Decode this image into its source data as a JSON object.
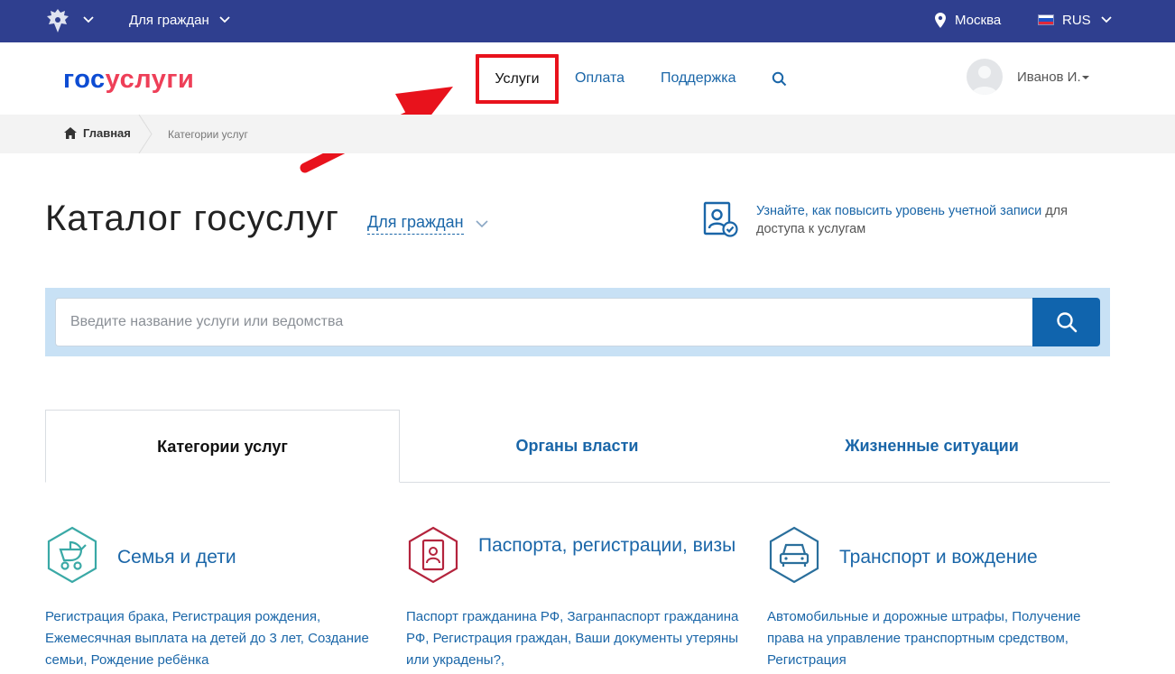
{
  "topbar": {
    "audience": "Для граждан",
    "location": "Москва",
    "language": "RUS",
    "colors": {
      "background": "#2f3f8f"
    }
  },
  "header": {
    "logo": {
      "part1": "гос",
      "part2": "услуги"
    },
    "nav": {
      "services": "Услуги",
      "payment": "Оплата",
      "support": "Поддержка"
    },
    "user": "Иванов И."
  },
  "breadcrumbs": {
    "home": "Главная",
    "current": "Категории услуг"
  },
  "catalog": {
    "title": "Каталог госуслуг",
    "audience": "Для граждан",
    "promo_link": "Узнайте, как повысить уровень учетной записи",
    "promo_rest": " для доступа к услугам"
  },
  "search": {
    "placeholder": "Введите название услуги или ведомства",
    "value": ""
  },
  "tabs": [
    {
      "label": "Категории услуг",
      "active": true
    },
    {
      "label": "Органы власти",
      "active": false
    },
    {
      "label": "Жизненные ситуации",
      "active": false
    }
  ],
  "categories": [
    {
      "icon": "stroller-icon",
      "title": "Семья и дети",
      "links": "Регистрация брака, Регистрация рождения, Ежемесячная выплата на детей до 3 лет, Создание семьи, Рождение ребёнка"
    },
    {
      "icon": "passport-icon",
      "title": "Паспорта, регистрации, визы",
      "links": "Паспорт гражданина РФ, Загранпаспорт гражданина РФ, Регистрация граждан, Ваши документы утеряны или украдены?,"
    },
    {
      "icon": "car-icon",
      "title": "Транспорт и вождение",
      "links": "Автомобильные и дорожные штрафы, Получение права на управление транспортным средством, Регистрация"
    }
  ],
  "colors": {
    "link": "#1a66a8",
    "search_band": "#c8e1f5",
    "search_button": "#1064ad",
    "highlight": "#e8121c",
    "family": "#3aa9a6",
    "passport": "#b4243d",
    "transport": "#2a6f9c"
  }
}
